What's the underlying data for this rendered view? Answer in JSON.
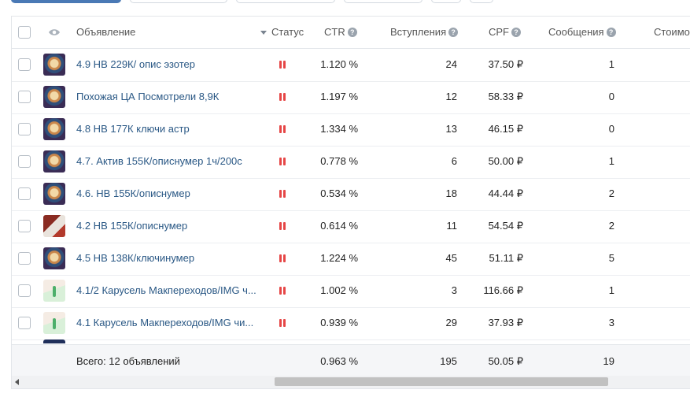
{
  "header": {
    "eye_icon": "eye-icon",
    "col_ad": "Объявление",
    "col_status": "Статус",
    "col_ctr": "CTR",
    "col_joins": "Вступления",
    "col_cpf": "CPF",
    "col_messages": "Сообщения",
    "col_cost": "Стоимо",
    "help_glyph": "?"
  },
  "rows": [
    {
      "name": "4.9 НВ 229К/ опис эзотер",
      "status": "paused",
      "ctr": "1.120 %",
      "joins": "24",
      "cpf": "37.50 ₽",
      "messages": "1"
    },
    {
      "name": "Похожая ЦА Посмотрели 8,9К",
      "status": "paused",
      "ctr": "1.197 %",
      "joins": "12",
      "cpf": "58.33 ₽",
      "messages": "0"
    },
    {
      "name": "4.8 НВ 177К ключи астр",
      "status": "paused",
      "ctr": "1.334 %",
      "joins": "13",
      "cpf": "46.15 ₽",
      "messages": "0"
    },
    {
      "name": "4.7. Актив 155К/описнумер 1ч/200с",
      "status": "paused",
      "ctr": "0.778 %",
      "joins": "6",
      "cpf": "50.00 ₽",
      "messages": "1"
    },
    {
      "name": "4.6. НВ 155К/описнумер",
      "status": "paused",
      "ctr": "0.534 %",
      "joins": "18",
      "cpf": "44.44 ₽",
      "messages": "2"
    },
    {
      "name": "4.2 НВ 155К/описнумер",
      "status": "paused",
      "ctr": "0.614 %",
      "joins": "11",
      "cpf": "54.54 ₽",
      "messages": "2"
    },
    {
      "name": "4.5 НВ 138К/ключинумер",
      "status": "paused",
      "ctr": "1.224 %",
      "joins": "45",
      "cpf": "51.11 ₽",
      "messages": "5"
    },
    {
      "name": "4.1/2 Карусель Макпереходов/IMG ч...",
      "status": "paused",
      "ctr": "1.002 %",
      "joins": "3",
      "cpf": "116.66 ₽",
      "messages": "1"
    },
    {
      "name": "4.1 Карусель Макпереходов/IMG чи...",
      "status": "paused",
      "ctr": "0.939 %",
      "joins": "29",
      "cpf": "37.93 ₽",
      "messages": "3"
    }
  ],
  "footer": {
    "total_label": "Всего: 12 объявлений",
    "ctr": "0.963 %",
    "joins": "195",
    "cpf": "50.05 ₽",
    "messages": "19"
  },
  "colors": {
    "link": "#2a5885",
    "pause": "#e64646",
    "primary_button": "#4a79b5"
  }
}
